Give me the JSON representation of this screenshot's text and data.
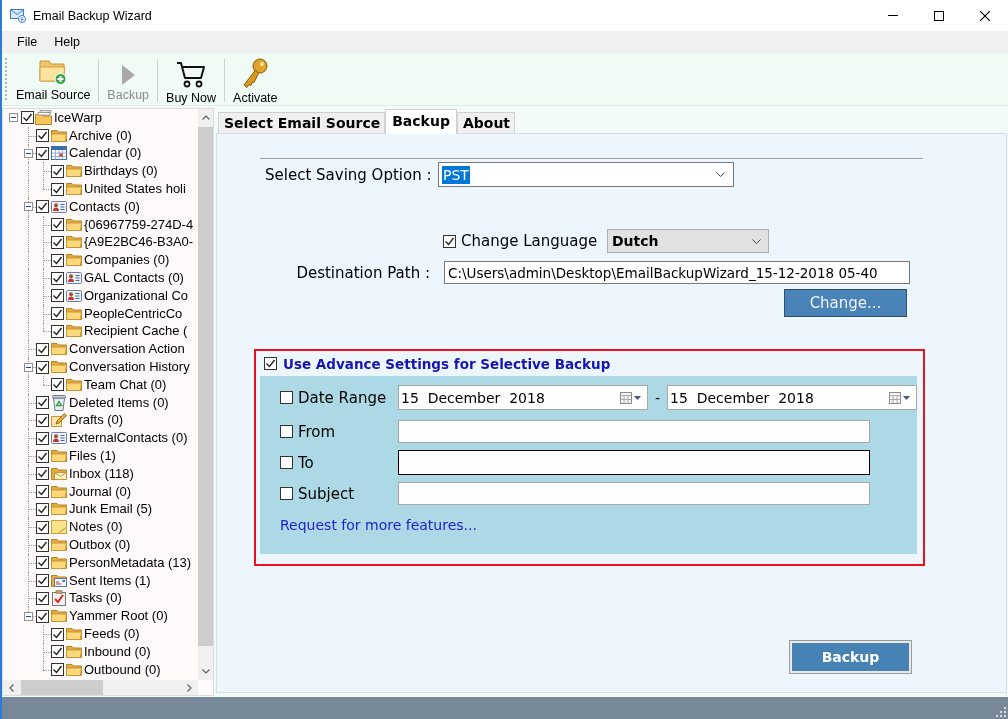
{
  "window": {
    "title": "Email Backup Wizard"
  },
  "menu": [
    "File",
    "Help"
  ],
  "toolbar": [
    {
      "label": "Email Source",
      "kind": "source",
      "disabled": false
    },
    {
      "label": "Backup",
      "kind": "run",
      "disabled": true
    },
    {
      "label": "Buy Now",
      "kind": "buy",
      "disabled": false
    },
    {
      "label": "Activate",
      "kind": "activate",
      "disabled": false
    }
  ],
  "tree": {
    "label": "IceWarp",
    "kind": "store",
    "checked": true,
    "expanded": true,
    "children": [
      {
        "label": "Archive (0)",
        "kind": "folder",
        "checked": true
      },
      {
        "label": "Calendar (0)",
        "kind": "calendar",
        "checked": true,
        "expanded": true,
        "children": [
          {
            "label": "Birthdays (0)",
            "kind": "folder",
            "checked": true
          },
          {
            "label": "United States holi",
            "kind": "folder",
            "checked": true
          }
        ]
      },
      {
        "label": "Contacts (0)",
        "kind": "contacts",
        "checked": true,
        "expanded": true,
        "children": [
          {
            "label": "{06967759-274D-4",
            "kind": "folder",
            "checked": true
          },
          {
            "label": "{A9E2BC46-B3A0-",
            "kind": "folder",
            "checked": true
          },
          {
            "label": "Companies (0)",
            "kind": "folder",
            "checked": true
          },
          {
            "label": "GAL Contacts (0)",
            "kind": "contacts",
            "checked": true
          },
          {
            "label": "Organizational Co",
            "kind": "contacts",
            "checked": true
          },
          {
            "label": "PeopleCentricCo",
            "kind": "folder",
            "checked": true
          },
          {
            "label": "Recipient Cache (",
            "kind": "folder",
            "checked": true
          }
        ]
      },
      {
        "label": "Conversation Action",
        "kind": "folder",
        "checked": true
      },
      {
        "label": "Conversation History",
        "kind": "folder",
        "checked": true,
        "expanded": true,
        "children": [
          {
            "label": "Team Chat (0)",
            "kind": "folder",
            "checked": true
          }
        ]
      },
      {
        "label": "Deleted Items (0)",
        "kind": "trash",
        "checked": true
      },
      {
        "label": "Drafts (0)",
        "kind": "drafts",
        "checked": true
      },
      {
        "label": "ExternalContacts (0)",
        "kind": "contacts",
        "checked": true
      },
      {
        "label": "Files (1)",
        "kind": "folder",
        "checked": true
      },
      {
        "label": "Inbox (118)",
        "kind": "inbox",
        "checked": true
      },
      {
        "label": "Journal (0)",
        "kind": "folder",
        "checked": true
      },
      {
        "label": "Junk Email (5)",
        "kind": "folder",
        "checked": true
      },
      {
        "label": "Notes (0)",
        "kind": "notes",
        "checked": true
      },
      {
        "label": "Outbox (0)",
        "kind": "folder",
        "checked": true
      },
      {
        "label": "PersonMetadata (13)",
        "kind": "folder",
        "checked": true
      },
      {
        "label": "Sent Items (1)",
        "kind": "sent",
        "checked": true
      },
      {
        "label": "Tasks (0)",
        "kind": "tasks",
        "checked": true
      },
      {
        "label": "Yammer Root (0)",
        "kind": "folder",
        "checked": true,
        "expanded": true,
        "children": [
          {
            "label": "Feeds (0)",
            "kind": "folder",
            "checked": true
          },
          {
            "label": "Inbound (0)",
            "kind": "folder",
            "checked": true
          },
          {
            "label": "Outbound (0)",
            "kind": "folder",
            "checked": true
          }
        ]
      }
    ]
  },
  "tabs": [
    {
      "label": "Select Email Source",
      "selected": false
    },
    {
      "label": "Backup",
      "selected": true
    },
    {
      "label": "About",
      "selected": false
    }
  ],
  "backup": {
    "saving_option": {
      "label": "Select Saving Option :",
      "value": "PST",
      "highlighted": true
    },
    "change_language": {
      "label": "Change Language",
      "checked": true,
      "value": "Dutch"
    },
    "destination": {
      "label": "Destination Path :",
      "value": "C:\\Users\\admin\\Desktop\\EmailBackupWizard_15-12-2018 05-40"
    },
    "change_button": "Change...",
    "advanced": {
      "label": "Use Advance Settings for Selective Backup",
      "checked": true,
      "filters": [
        {
          "kind": "date-range",
          "label": "Date Range",
          "checked": false,
          "start_date": "15  December  2018",
          "separator": "-",
          "end_date": "15  December  2018"
        },
        {
          "kind": "text",
          "label": "From",
          "checked": false,
          "focused": false
        },
        {
          "kind": "text",
          "label": "To",
          "checked": false,
          "focused": true
        },
        {
          "kind": "text",
          "label": "Subject",
          "checked": false,
          "focused": false
        }
      ],
      "link": "Request for more features..."
    },
    "backup_button": "Backup"
  }
}
